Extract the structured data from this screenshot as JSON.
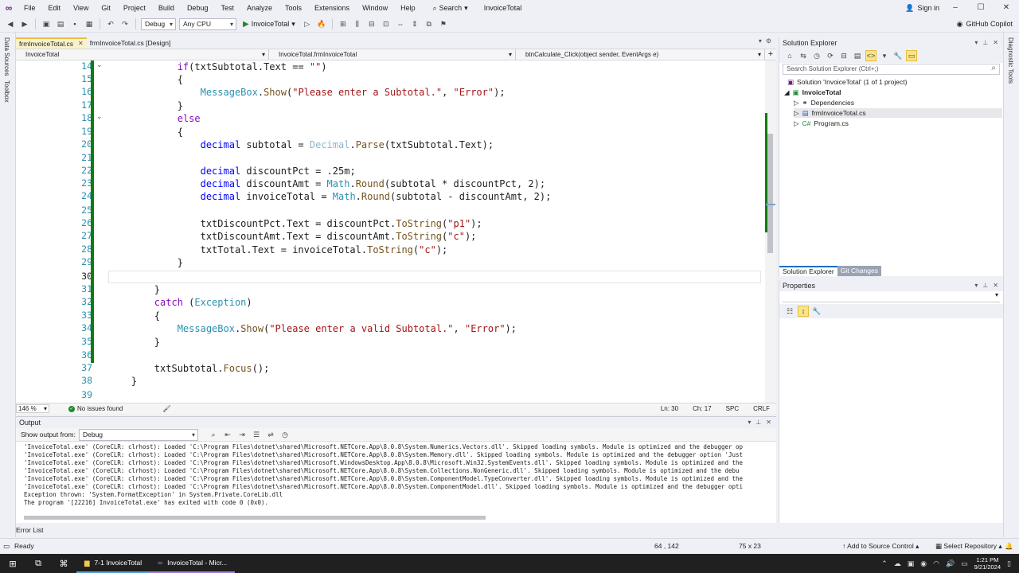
{
  "menubar": {
    "items": [
      "File",
      "Edit",
      "View",
      "Git",
      "Project",
      "Build",
      "Debug",
      "Test",
      "Analyze",
      "Tools",
      "Extensions",
      "Window",
      "Help"
    ],
    "search_label": "Search",
    "window_title": "InvoiceTotal",
    "signin_label": "Sign in"
  },
  "toolbar": {
    "config": "Debug",
    "platform": "Any CPU",
    "run_label": "InvoiceTotal",
    "copilot_label": "GitHub Copilot"
  },
  "left_strip": {
    "tab1": "Data Sources",
    "tab2": "Toolbox"
  },
  "right_strip": {
    "tab1": "Diagnostic Tools"
  },
  "doc_tabs": [
    {
      "label": "frmInvoiceTotal.cs",
      "active": true
    },
    {
      "label": "frmInvoiceTotal.cs [Design]",
      "active": false
    }
  ],
  "navbar": {
    "project": "InvoiceTotal",
    "class": "InvoiceTotal.frmInvoiceTotal",
    "member": "btnCalculate_Click(object sender, EventArgs e)"
  },
  "editor": {
    "lines": [
      {
        "n": "14",
        "html": "            <span class=\"ctl\">if</span>(txtSubtotal.Text == <span class=\"str\">\"\"</span>)"
      },
      {
        "n": "15",
        "html": "            {"
      },
      {
        "n": "16",
        "html": "                <span class=\"ty\">MessageBox</span>.<span class=\"fn\">Show</span>(<span class=\"str\">\"Please enter a Subtotal.\"</span>, <span class=\"str\">\"Error\"</span>);"
      },
      {
        "n": "17",
        "html": "            }"
      },
      {
        "n": "18",
        "html": "            <span class=\"ctl\">else</span>"
      },
      {
        "n": "19",
        "html": "            {"
      },
      {
        "n": "20",
        "html": "                <span class=\"kw\">decimal</span> subtotal = <span class=\"typ\">Decimal</span>.<span class=\"fn\">Parse</span>(txtSubtotal.Text);"
      },
      {
        "n": "21",
        "html": ""
      },
      {
        "n": "22",
        "html": "                <span class=\"kw\">decimal</span> discountPct = .25m;"
      },
      {
        "n": "23",
        "html": "                <span class=\"kw\">decimal</span> discountAmt = <span class=\"ty\">Math</span>.<span class=\"fn\">Round</span>(subtotal * discountPct, 2);"
      },
      {
        "n": "24",
        "html": "                <span class=\"kw\">decimal</span> invoiceTotal = <span class=\"ty\">Math</span>.<span class=\"fn\">Round</span>(subtotal - discountAmt, 2);"
      },
      {
        "n": "25",
        "html": ""
      },
      {
        "n": "26",
        "html": "                txtDiscountPct.Text = discountPct.<span class=\"fn\">ToString</span>(<span class=\"str\">\"p1\"</span>);"
      },
      {
        "n": "27",
        "html": "                txtDiscountAmt.Text = discountAmt.<span class=\"fn\">ToString</span>(<span class=\"str\">\"c\"</span>);"
      },
      {
        "n": "28",
        "html": "                txtTotal.Text = invoiceTotal.<span class=\"fn\">ToString</span>(<span class=\"str\">\"c\"</span>);"
      },
      {
        "n": "29",
        "html": "            }"
      },
      {
        "n": "30",
        "html": ""
      },
      {
        "n": "31",
        "html": "        }"
      },
      {
        "n": "32",
        "html": "        <span class=\"ctl\">catch</span> (<span class=\"ty\">Exception</span>)"
      },
      {
        "n": "33",
        "html": "        {"
      },
      {
        "n": "34",
        "html": "            <span class=\"ty\">MessageBox</span>.<span class=\"fn\">Show</span>(<span class=\"str\">\"Please enter a valid Subtotal.\"</span>, <span class=\"str\">\"Error\"</span>);"
      },
      {
        "n": "35",
        "html": "        }"
      },
      {
        "n": "36",
        "html": ""
      },
      {
        "n": "37",
        "html": "        txtSubtotal.<span class=\"fn\">Focus</span>();"
      },
      {
        "n": "38",
        "html": "    }"
      },
      {
        "n": "39",
        "html": ""
      }
    ]
  },
  "editor_status": {
    "zoom": "146 %",
    "issues": "No issues found",
    "ln": "Ln: 30",
    "ch": "Ch: 17",
    "spc": "SPC",
    "crlf": "CRLF"
  },
  "output": {
    "title": "Output",
    "show_from_label": "Show output from:",
    "show_from_value": "Debug",
    "lines": [
      "'InvoiceTotal.exe' (CoreCLR: clrhost): Loaded 'C:\\Program Files\\dotnet\\shared\\Microsoft.NETCore.App\\8.0.8\\System.Numerics.Vectors.dll'. Skipped loading symbols. Module is optimized and the debugger op",
      "'InvoiceTotal.exe' (CoreCLR: clrhost): Loaded 'C:\\Program Files\\dotnet\\shared\\Microsoft.NETCore.App\\8.0.8\\System.Memory.dll'. Skipped loading symbols. Module is optimized and the debugger option 'Just",
      "'InvoiceTotal.exe' (CoreCLR: clrhost): Loaded 'C:\\Program Files\\dotnet\\shared\\Microsoft.WindowsDesktop.App\\8.0.8\\Microsoft.Win32.SystemEvents.dll'. Skipped loading symbols. Module is optimized and the",
      "'InvoiceTotal.exe' (CoreCLR: clrhost): Loaded 'C:\\Program Files\\dotnet\\shared\\Microsoft.NETCore.App\\8.0.8\\System.Collections.NonGeneric.dll'. Skipped loading symbols. Module is optimized and the debu",
      "'InvoiceTotal.exe' (CoreCLR: clrhost): Loaded 'C:\\Program Files\\dotnet\\shared\\Microsoft.NETCore.App\\8.0.8\\System.ComponentModel.TypeConverter.dll'. Skipped loading symbols. Module is optimized and the",
      "'InvoiceTotal.exe' (CoreCLR: clrhost): Loaded 'C:\\Program Files\\dotnet\\shared\\Microsoft.NETCore.App\\8.0.8\\System.ComponentModel.dll'. Skipped loading symbols. Module is optimized and the debugger opti",
      "Exception thrown: 'System.FormatException' in System.Private.CoreLib.dll",
      "The program '[22216] InvoiceTotal.exe' has exited with code 0 (0x0)."
    ]
  },
  "error_list_label": "Error List",
  "solution_explorer": {
    "title": "Solution Explorer",
    "search_placeholder": "Search Solution Explorer (Ctrl+;)",
    "items": [
      {
        "label": "Solution 'InvoiceTotal' (1 of 1 project)",
        "icon": "solution-icon"
      },
      {
        "label": "InvoiceTotal",
        "icon": "csharp-project-icon"
      },
      {
        "label": "Dependencies",
        "icon": "dependencies-icon"
      },
      {
        "label": "frmInvoiceTotal.cs",
        "icon": "form-file-icon"
      },
      {
        "label": "Program.cs",
        "icon": "csharp-file-icon"
      }
    ],
    "tabs": [
      "Solution Explorer",
      "Git Changes"
    ]
  },
  "properties": {
    "title": "Properties"
  },
  "statusbar": {
    "ready": "Ready",
    "position": "64 , 142",
    "size": "75 x 23",
    "source_control": "Add to Source Control",
    "repository": "Select Repository"
  },
  "taskbar": {
    "apps": [
      {
        "label": "7-1 InvoiceTotal",
        "icon": "folder-icon"
      },
      {
        "label": "InvoiceTotal - Micr...",
        "icon": "visual-studio-icon"
      }
    ],
    "time": "1:21 PM",
    "date": "9/21/2024"
  }
}
